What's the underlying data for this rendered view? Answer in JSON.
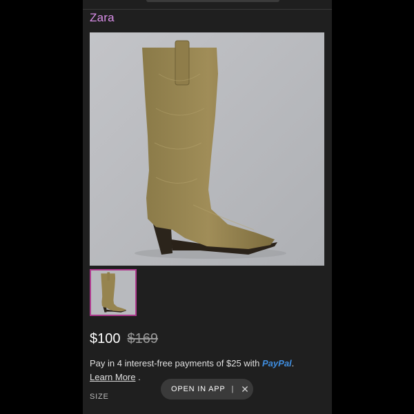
{
  "brand": "Zara",
  "price": {
    "current": "$100",
    "original": "$169"
  },
  "payment": {
    "text": "Pay in 4 interest-free payments of $25 with ",
    "provider": "PayPal",
    "suffix": ".",
    "learn_more": "Learn More",
    "learn_more_suffix": " ."
  },
  "size_label": "SIZE",
  "open_in_app": {
    "label": "OPEN IN APP",
    "separator": "|",
    "close_glyph": "✕"
  },
  "colors": {
    "brand": "#d98ee8",
    "paypal": "#3f8ee0",
    "thumb_border": "#b03b8f",
    "background": "#1f1f1f"
  },
  "icons": {
    "close": "close-icon"
  }
}
